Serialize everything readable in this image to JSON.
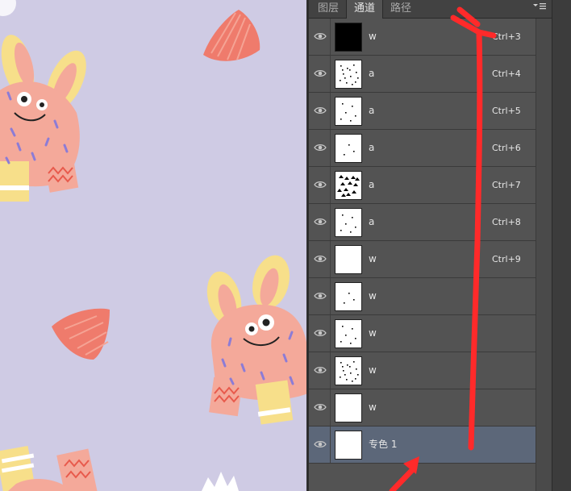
{
  "tabs": [
    {
      "label": "图层",
      "active": false
    },
    {
      "label": "通道",
      "active": true
    },
    {
      "label": "路径",
      "active": false
    }
  ],
  "channels": [
    {
      "name": "w",
      "shortcut": "Ctrl+3",
      "thumb": "black",
      "visible": true,
      "selected": false
    },
    {
      "name": "a",
      "shortcut": "Ctrl+4",
      "thumb": "dots-heavy",
      "visible": true,
      "selected": false
    },
    {
      "name": "a",
      "shortcut": "Ctrl+5",
      "thumb": "dots-light",
      "visible": true,
      "selected": false
    },
    {
      "name": "a",
      "shortcut": "Ctrl+6",
      "thumb": "dots-sparse",
      "visible": true,
      "selected": false
    },
    {
      "name": "a",
      "shortcut": "Ctrl+7",
      "thumb": "dots-blob",
      "visible": true,
      "selected": false
    },
    {
      "name": "a",
      "shortcut": "Ctrl+8",
      "thumb": "dots-light",
      "visible": true,
      "selected": false
    },
    {
      "name": "w",
      "shortcut": "Ctrl+9",
      "thumb": "white",
      "visible": true,
      "selected": false
    },
    {
      "name": "w",
      "shortcut": "",
      "thumb": "dots-sparse",
      "visible": true,
      "selected": false
    },
    {
      "name": "w",
      "shortcut": "",
      "thumb": "dots-light",
      "visible": true,
      "selected": false
    },
    {
      "name": "w",
      "shortcut": "",
      "thumb": "dots-heavy",
      "visible": true,
      "selected": false
    },
    {
      "name": "w",
      "shortcut": "",
      "thumb": "white",
      "visible": true,
      "selected": false
    },
    {
      "name": "专色 1",
      "shortcut": "",
      "thumb": "white",
      "visible": true,
      "selected": true
    }
  ],
  "colors": {
    "canvas_bg": "#cfcbe4",
    "annotation_red": "#ff2a2a",
    "selected_row": "#5c6779",
    "monster_pink": "#f4a99a",
    "monster_yellow": "#f7df8a",
    "shell_red": "#ef7b6c"
  },
  "icons": {
    "eye": "eye-icon",
    "menu": "panel-menu-icon"
  }
}
